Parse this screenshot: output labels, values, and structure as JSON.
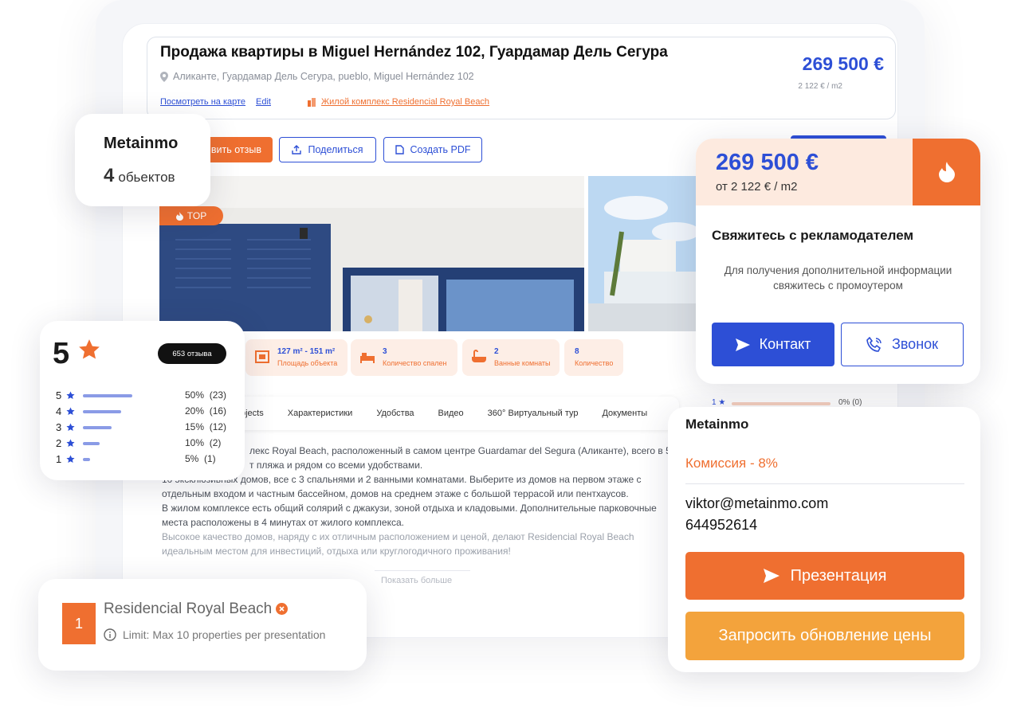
{
  "listing": {
    "title": "Продажа квартиры в Miguel Hernández 102, Гуардамар Дель Сегура",
    "address": "Аликанте, Гуардамар Дель Сегура, pueblo, Miguel Hernández 102",
    "map_link": "Посмотреть на карте",
    "edit_link": "Edit",
    "complex_link": "Жилой комплекс Residencial Royal Beach",
    "price": "269 500 €",
    "price_per_m2": "2 122 € / m2",
    "review_button": "вить отзыв",
    "share_button": "Поделиться",
    "pdf_button": "Создать PDF",
    "top_badge": "TOP",
    "features": [
      {
        "value": "127 m² - 151 m²",
        "label": "Площадь объекта",
        "icon": "area-icon"
      },
      {
        "value": "3",
        "label": "Количество спален",
        "icon": "bed-icon"
      },
      {
        "value": "2",
        "label": "Ванные комнаты",
        "icon": "bath-icon"
      },
      {
        "value": "8",
        "label": "Количество",
        "icon": ""
      }
    ],
    "tabs": [
      "bjects",
      "Характеристики",
      "Удобства",
      "Видео",
      "360° Виртуальный тур",
      "Документы"
    ],
    "description": [
      "лекс Royal Beach, расположенный в самом центре Guardamar del Segura (Аликанте), всего в 5",
      "т пляжа и рядом со всеми удобствами.",
      "10 эксклюзивных домов, все с 3 спальнями и 2 ванными комнатами. Выберите из домов на первом этаже с",
      "отдельным входом и частным бассейном, домов на среднем этаже с большой террасой или пентхаусов.",
      "В жилом комплексе есть общий солярий с джакузи, зоной отдыха и кладовыми. Дополнительные парковочные",
      "места расположены в 4 минутах от жилого комплекса.",
      "Высокое качество домов, наряду с их отличным расположением и ценой, делают Residencial Royal Beach",
      "идеальным местом для инвестиций, отдыха или круглогодичного проживания!"
    ],
    "show_more": "Показать больше",
    "bg_rating": {
      "num": "1",
      "pct": "0% (0)"
    }
  },
  "agency_card": {
    "name": "Metainmo",
    "count": "4",
    "count_label": "обьектов"
  },
  "rating_card": {
    "score": "5",
    "reviews": "653 отзыва",
    "rows": [
      {
        "stars": "5",
        "pct": "50%",
        "count": "(23)",
        "fraction": 0.5
      },
      {
        "stars": "4",
        "pct": "20%",
        "count": "(16)",
        "fraction": 0.39
      },
      {
        "stars": "3",
        "pct": "15%",
        "count": "(12)",
        "fraction": 0.29
      },
      {
        "stars": "2",
        "pct": "10%",
        "count": "(2)",
        "fraction": 0.17
      },
      {
        "stars": "1",
        "pct": "5%",
        "count": "(1)",
        "fraction": 0.07
      }
    ]
  },
  "presentation_card": {
    "index": "1",
    "name": "Residencial Royal Beach",
    "limit": "Limit: Max 10 properties per presentation"
  },
  "contact_card": {
    "price": "269 500 €",
    "price_per_m2": "от 2 122 € / m2",
    "heading": "Свяжитесь с рекламодателем",
    "text_line1": "Для получения дополнительной информации",
    "text_line2": "свяжитесь с промоутером",
    "contact_button": "Контакт",
    "call_button": "Звонок"
  },
  "agent_card": {
    "name": "Metainmo",
    "commission": "Комиссия - 8%",
    "email": "viktor@metainmo.com",
    "phone": "644952614",
    "presentation_button": "Презентация",
    "price_update_button": "Запросить обновление цены"
  },
  "colors": {
    "brand_orange": "#ef6f30",
    "brand_blue": "#2d4fd6",
    "accent_yellow": "#f3a33c"
  }
}
